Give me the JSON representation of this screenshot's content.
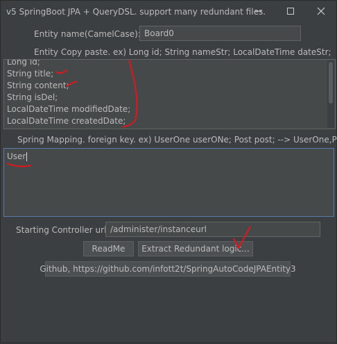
{
  "window": {
    "title": "v5 SpringBoot JPA + QueryDSL. support many redundant files.",
    "minimize_glyph": "─",
    "maximize_glyph": "☐",
    "close_glyph": "✕"
  },
  "entity": {
    "label": "Entity name(CamelCase): :",
    "value": "Board0"
  },
  "copy_paste": {
    "label": "Entity Copy paste. ex) Long id; String nameStr; LocalDateTime dateStr;",
    "lines": [
      "Long id;",
      "String title;",
      "String content;",
      "String isDel;",
      "LocalDateTime modifiedDate;",
      "LocalDateTime createdDate;"
    ]
  },
  "mapping": {
    "label": "Spring Mapping. foreign key. ex) UserOne userONe; Post post; --> UserOne,Post",
    "value": "User"
  },
  "controller": {
    "label": "Starting Controller url:",
    "value": "/administer/instanceurl"
  },
  "buttons": {
    "readme": "ReadMe",
    "extract": "Extract Redundant logic...",
    "github": "Github, https://github.com/infott2t/SpringAutoCodeJPAEntity3"
  },
  "colors": {
    "background": "#3c3f41",
    "field": "#45494a",
    "text": "#bbbbbb",
    "annotation": "#e0161a"
  }
}
